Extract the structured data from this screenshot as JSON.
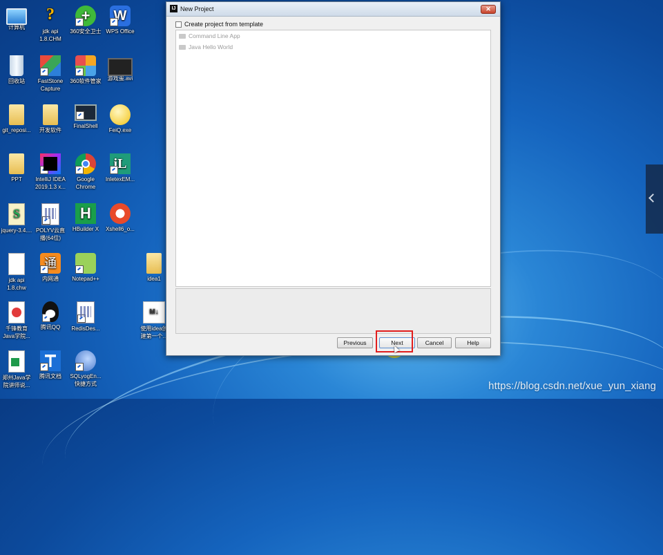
{
  "desktop": {
    "icons": [
      {
        "label": "计算机",
        "glyph": "computer-icon",
        "shortcut": false
      },
      {
        "label": "jdk api\n1.8.CHM",
        "glyph": "help-file-icon",
        "shortcut": false
      },
      {
        "label": "360安全卫士",
        "glyph": "360-security-icon",
        "shortcut": true
      },
      {
        "label": "WPS Office",
        "glyph": "wps-icon",
        "shortcut": true
      },
      {
        "label": "回收站",
        "glyph": "recycle-bin-icon",
        "shortcut": false
      },
      {
        "label": "FastStone\nCapture",
        "glyph": "faststone-icon",
        "shortcut": true
      },
      {
        "label": "360软件管家",
        "glyph": "software-manager-icon",
        "shortcut": true
      },
      {
        "label": "游戏蛋.avi",
        "glyph": "video-file-icon",
        "shortcut": false
      },
      {
        "label": "git_reposi...",
        "glyph": "folder-icon",
        "shortcut": false
      },
      {
        "label": "开发软件",
        "glyph": "folder-icon",
        "shortcut": false
      },
      {
        "label": "FinalShell",
        "glyph": "finalshell-icon",
        "shortcut": true
      },
      {
        "label": "FeiQ.exe",
        "glyph": "feiq-icon",
        "shortcut": false
      },
      {
        "label": "PPT",
        "glyph": "folder-icon",
        "shortcut": false
      },
      {
        "label": "IntelliJ IDEA\n2019.1.3 x...",
        "glyph": "intellij-icon",
        "shortcut": true
      },
      {
        "label": "Google\nChrome",
        "glyph": "chrome-icon",
        "shortcut": true
      },
      {
        "label": "InletexEM...",
        "glyph": "inletex-icon",
        "shortcut": true
      },
      {
        "label": "jquery-3.4....",
        "glyph": "script-file-icon",
        "shortcut": false
      },
      {
        "label": "POLYV云直\n播(64位)",
        "glyph": "calculator-doc-icon",
        "shortcut": true
      },
      {
        "label": "HBuilder X",
        "glyph": "hbuilder-icon",
        "shortcut": false
      },
      {
        "label": "Xshell6_o...",
        "glyph": "xshell-icon",
        "shortcut": false
      },
      {
        "label": "jdk api\n1.8.chw",
        "glyph": "document-icon",
        "shortcut": false
      },
      {
        "label": "内网通",
        "glyph": "neiwangtong-icon",
        "shortcut": true
      },
      {
        "label": "Notepad++",
        "glyph": "notepad-plus-icon",
        "shortcut": true
      },
      {
        "label": "idea1",
        "glyph": "folder-icon",
        "shortcut": false
      },
      {
        "label": "千锋教育\nJava学院...",
        "glyph": "pdf-doc-icon",
        "shortcut": false
      },
      {
        "label": "腾讯QQ",
        "glyph": "qq-icon",
        "shortcut": true
      },
      {
        "label": "RedisDes...",
        "glyph": "calculator-doc-icon",
        "shortcut": true
      },
      {
        "label": "使用idea创\n建第一个...",
        "glyph": "markdown-icon",
        "shortcut": false
      },
      {
        "label": "郑州Java学\n院讲师说...",
        "glyph": "spreadsheet-doc-icon",
        "shortcut": false
      },
      {
        "label": "腾讯文档",
        "glyph": "tencent-docs-icon",
        "shortcut": true
      },
      {
        "label": "SQLyogEn...\n快捷方式",
        "glyph": "sqlyog-icon",
        "shortcut": true
      }
    ]
  },
  "dialog": {
    "title": "New Project",
    "app_icon_text": "IJ",
    "close_glyph": "✕",
    "create_from_template": {
      "label": "Create project from template",
      "checked": false
    },
    "templates": [
      "Command Line App",
      "Java Hello World"
    ],
    "buttons": {
      "previous": "Previous",
      "next": "Next",
      "cancel": "Cancel",
      "help": "Help"
    },
    "highlight_color": "#e11d1d"
  },
  "side_panel": {
    "chevron": "chevron-left-icon"
  },
  "watermark": "https://blog.csdn.net/xue_yun_xiang"
}
